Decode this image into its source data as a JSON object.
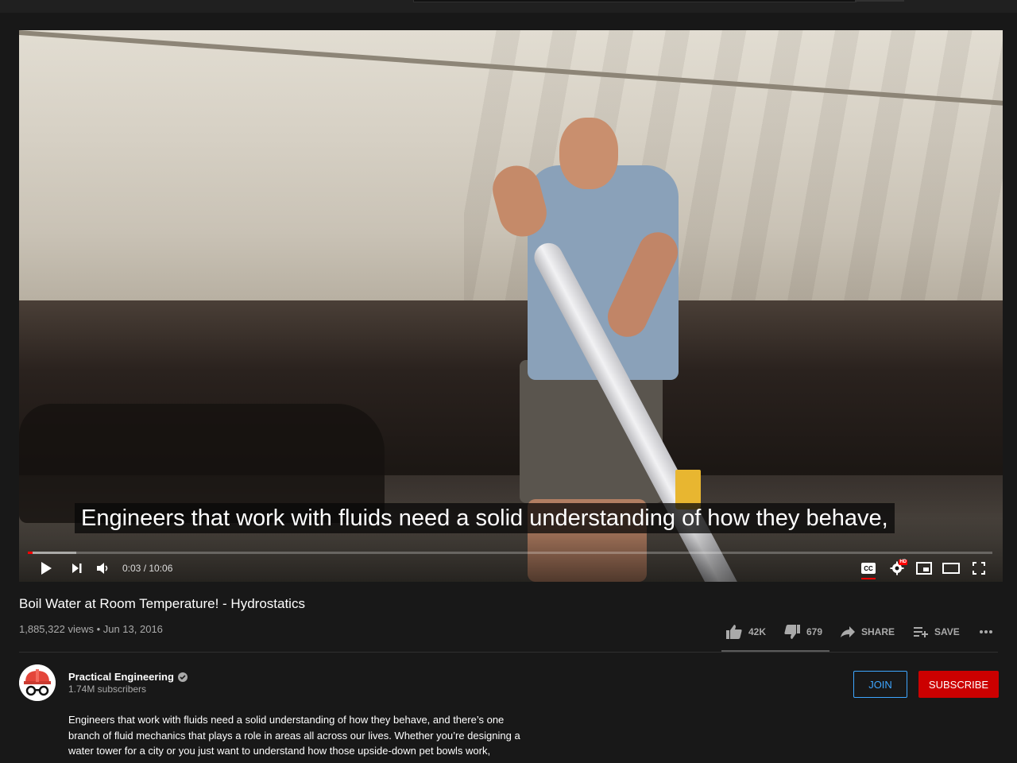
{
  "player": {
    "caption": "Engineers that work with fluids need a solid understanding of how they behave,",
    "current_time": "0:03",
    "duration": "10:06",
    "time_display": "0:03 / 10:06",
    "progress_fraction": 0.005,
    "buffered_fraction": 0.05,
    "controls": {
      "left": [
        "play-icon",
        "next-icon",
        "volume-icon"
      ],
      "right": [
        "captions-icon",
        "settings-icon",
        "miniplayer-icon",
        "theater-icon",
        "fullscreen-icon"
      ],
      "settings_badge": "HD",
      "cc_label": "CC"
    }
  },
  "video": {
    "title": "Boil Water at Room Temperature! - Hydrostatics",
    "meta": "1,885,322 views • Jun 13, 2016",
    "likes": "42K",
    "dislikes": "679",
    "share_label": "SHARE",
    "save_label": "SAVE"
  },
  "channel": {
    "name": "Practical Engineering",
    "subscribers": "1.74M subscribers",
    "join_label": "JOIN",
    "subscribe_label": "SUBSCRIBE"
  },
  "description": {
    "lines": [
      "Engineers that work with fluids need a solid understanding of how they behave, and there’s one",
      "branch of fluid mechanics that plays a role in areas all across our lives. Whether you’re designing a",
      "water tower for a city or you just want to understand how those upside-down pet bowls work,"
    ]
  },
  "colors": {
    "background": "#181818",
    "subscribe": "#cc0000",
    "join": "#3ea6ff",
    "progress": "#ff0000"
  }
}
